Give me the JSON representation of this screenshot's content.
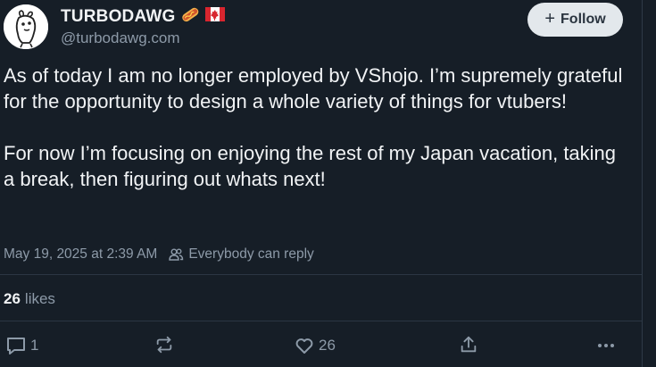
{
  "author": {
    "display_name": "TURBODAWG",
    "handle": "@turbodawg.com",
    "emoji_icons": [
      "hotdog-icon",
      "canada-flag-icon"
    ]
  },
  "follow_button": {
    "label": "Follow",
    "icon": "plus-icon"
  },
  "post": {
    "text": "As of today I am no longer employed by VShojo. I’m supremely grateful for the opportunity to design a whole variety of things for vtubers!\n\nFor now I’m focusing on enjoying the rest of my Japan vacation, taking a break, then figuring out whats next!",
    "timestamp": "May 19, 2025 at 2:39 AM",
    "reply_setting": "Everybody can reply"
  },
  "stats": {
    "likes_count": "26",
    "likes_label": "likes"
  },
  "actions": {
    "reply_count": "1",
    "repost_count": "",
    "like_count": "26"
  },
  "colors": {
    "background": "#161e27",
    "text": "#f1f3f5",
    "muted": "#8d9aa8",
    "follow_bg": "#e3e8ec"
  }
}
